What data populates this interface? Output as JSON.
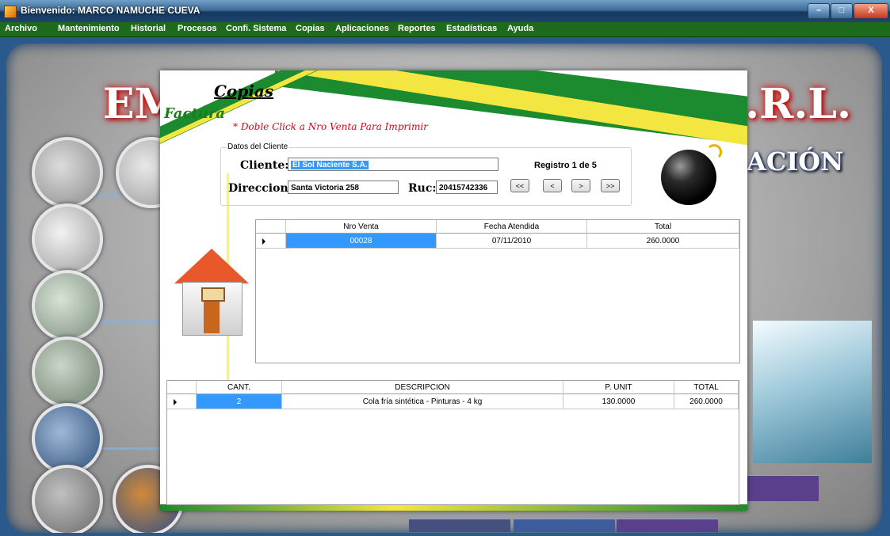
{
  "window": {
    "title": "Bienvenido: MARCO NAMUCHE CUEVA",
    "min": "–",
    "max": "□",
    "close": "X"
  },
  "menu": [
    "Archivo",
    "Mantenimiento",
    "Historial",
    "Procesos",
    "Confi. Sistema",
    "Copias",
    "Aplicaciones",
    "Reportes",
    "Estadísticas",
    "Ayuda"
  ],
  "background": {
    "brand_left": "EM",
    "brand_right": ".R.L.",
    "sub_right": "ACIÓN"
  },
  "form": {
    "title": "Copias",
    "subtitle": "Factura",
    "hint": "* Doble Click a Nro Venta Para Imprimir",
    "group_label": "Datos del Cliente",
    "cliente_label": "Cliente:",
    "cliente_value": "El Sol Naciente S.A.",
    "direccion_label": "Direccion:",
    "direccion_value": "Santa Victoria 258",
    "ruc_label": "Ruc:",
    "ruc_value": "20415742336",
    "registro": "Registro 1 de 5",
    "nav": {
      "first": "<<",
      "prev": "<",
      "next": ">",
      "last": ">>"
    }
  },
  "ventas_grid": {
    "columns": [
      "Nro Venta",
      "Fecha Atendida",
      "Total"
    ],
    "rows": [
      {
        "nro": "00028",
        "fecha": "07/11/2010",
        "total": "260.0000"
      }
    ]
  },
  "detalle_grid": {
    "columns": [
      "CANT.",
      "DESCRIPCION",
      "P. UNIT",
      "TOTAL"
    ],
    "rows": [
      {
        "cant": "2",
        "descripcion": "Cola fría sintética - Pinturas - 4 kg",
        "punit": "130.0000",
        "total": "260.0000"
      }
    ]
  },
  "colors": {
    "menubar": "#1e6b1e",
    "selection": "#3399ff",
    "hint": "#e8001c",
    "subtitle": "#1a7d1a"
  }
}
